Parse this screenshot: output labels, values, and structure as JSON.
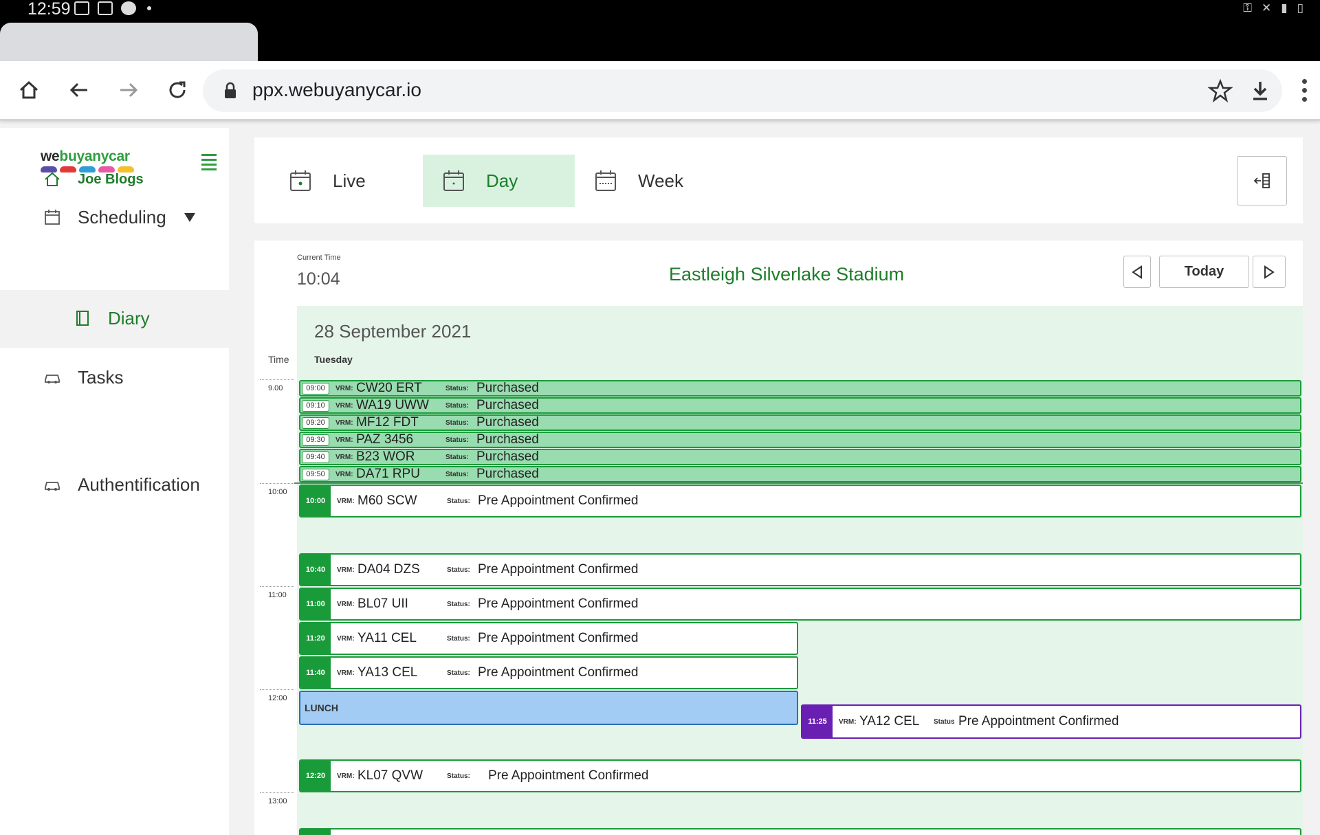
{
  "status_bar": {
    "time": "12:59"
  },
  "browser": {
    "url": "ppx.webuyanycar.io"
  },
  "sidebar": {
    "logo": {
      "we": "we",
      "buyanycar": "buyanycar"
    },
    "user": "Joe Blogs",
    "scheduling": "Scheduling",
    "diary": "Diary",
    "tasks": "Tasks",
    "authentification": "Authentification"
  },
  "views": {
    "live": "Live",
    "day": "Day",
    "week": "Week",
    "active": "Day"
  },
  "diary": {
    "current_time_label": "Current Time",
    "current_time": "10:04",
    "site": "Eastleigh Silverlake Stadium",
    "today_label": "Today",
    "date": "28 September 2021",
    "weekday": "Tuesday",
    "time_header": "Time",
    "vrm_key": "VRM:",
    "status_key": "Status:",
    "status_key_alt": "Status",
    "hours": [
      "9.00",
      "10:00",
      "11:00",
      "12:00",
      "13:00"
    ],
    "lunch_label": "LUNCH",
    "appointments": [
      {
        "time": "09:00",
        "vrm": "CW20 ERT",
        "status": "Purchased"
      },
      {
        "time": "09:10",
        "vrm": "WA19 UWW",
        "status": "Purchased"
      },
      {
        "time": "09:20",
        "vrm": "MF12 FDT",
        "status": "Purchased"
      },
      {
        "time": "09:30",
        "vrm": "PAZ 3456",
        "status": "Purchased"
      },
      {
        "time": "09:40",
        "vrm": "B23 WOR",
        "status": "Purchased"
      },
      {
        "time": "09:50",
        "vrm": "DA71 RPU",
        "status": "Purchased"
      },
      {
        "time": "10:00",
        "vrm": "M60 SCW",
        "status": "Pre Appointment Confirmed"
      },
      {
        "time": "10:40",
        "vrm": "DA04 DZS",
        "status": "Pre Appointment Confirmed"
      },
      {
        "time": "11:00",
        "vrm": "BL07 UII",
        "status": "Pre Appointment Confirmed"
      },
      {
        "time": "11:20",
        "vrm": "YA11 CEL",
        "status": "Pre Appointment Confirmed"
      },
      {
        "time": "11:40",
        "vrm": "YA13 CEL",
        "status": "Pre Appointment Confirmed"
      },
      {
        "time": "11:25",
        "vrm": "YA12 CEL",
        "status": "Pre Appointment Confirmed"
      },
      {
        "time": "12:20",
        "vrm": "KL07 QVW",
        "status": "Pre Appointment Confirmed"
      }
    ]
  },
  "colors": {
    "brand_green": "#1a9b3a",
    "purchased_fill": "#98dcaf",
    "lunch_fill": "#a3ccf5",
    "overlap_purple": "#6a1fb3",
    "day_background": "#e6f5ea"
  }
}
